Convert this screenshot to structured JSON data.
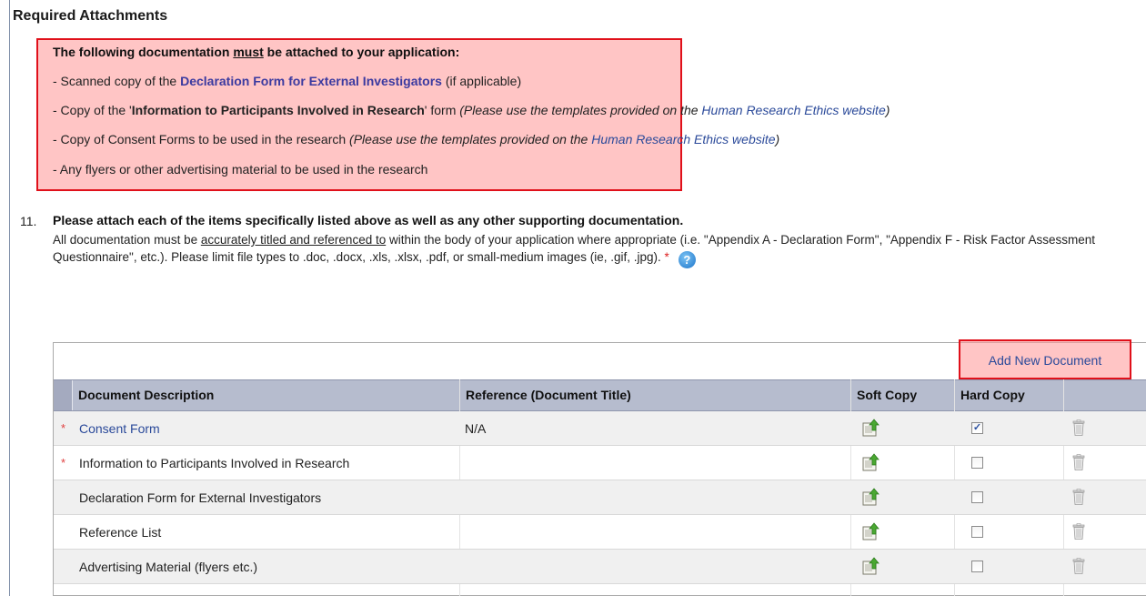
{
  "section_title": "Required Attachments",
  "requirements": {
    "intro_pre": "The following documentation ",
    "intro_must": "must",
    "intro_post": " be attached to your application:",
    "item1_pre": "- Scanned copy of the ",
    "item1_link": "Declaration Form for External Investigators",
    "item1_post": " (if applicable)",
    "item2_pre": "- Copy of the '",
    "item2_bold": "Information to Participants Involved in Research",
    "item2_mid": "' form ",
    "item2_ital": "(Please use the templates provided on the ",
    "item2_link": "Human Research Ethics website",
    "item2_end": ")",
    "item3_pre": "- Copy of Consent Forms to be used in the research ",
    "item3_ital": "(Please use the templates provided on the ",
    "item3_link": "Human Research Ethics website",
    "item3_end": ")",
    "item4": "- Any flyers or other advertising material to be used in the research"
  },
  "question": {
    "number": "11.",
    "title": "Please attach each of the items specifically listed above as well as any other supporting documentation.",
    "body_pre": "All documentation must be ",
    "body_underline": "accurately titled and referenced to",
    "body_post": " within the body of your application where appropriate (i.e. \"Appendix A - Declaration Form\", \"Appendix F - Risk Factor Assessment Questionnaire\", etc.). Please limit file types to .doc, .docx, .xls, .xlsx, .pdf, or small-medium images (ie, .gif, .jpg).",
    "required_mark": " *",
    "help_icon": "help-icon"
  },
  "table": {
    "add_label": "Add New Document",
    "headers": {
      "description": "Document Description",
      "reference": "Reference (Document Title)",
      "soft": "Soft Copy",
      "hard": "Hard Copy"
    },
    "rows": [
      {
        "required": "*",
        "description": "Consent Form",
        "reference": "N/A",
        "hard_checked": "✓"
      },
      {
        "required": "*",
        "description": "Information to Participants Involved in Research",
        "reference": "",
        "hard_checked": ""
      },
      {
        "required": "",
        "description": "Declaration Form for External Investigators",
        "reference": "",
        "hard_checked": ""
      },
      {
        "required": "",
        "description": "Reference List",
        "reference": "",
        "hard_checked": ""
      },
      {
        "required": "",
        "description": "Advertising Material (flyers etc.)",
        "reference": "",
        "hard_checked": ""
      }
    ]
  },
  "colors": {
    "highlight_fill": "#ff9696",
    "highlight_border": "#e0101a",
    "link": "#2b4a9a",
    "header_bg": "#b6bcce"
  }
}
